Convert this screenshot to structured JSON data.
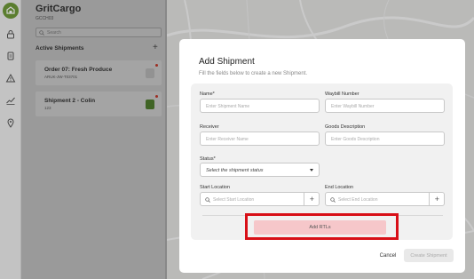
{
  "sidebar": {
    "brand": "GritCargo",
    "code": "GCCH03",
    "search_placeholder": "Search",
    "active_title": "Active Shipments",
    "shipments": [
      {
        "title": "Order 07: Fresh Produce",
        "subtitle": "ARUK-JW-T03701"
      },
      {
        "title": "Shipment 2 - Colin",
        "subtitle": "123"
      }
    ]
  },
  "colors": {
    "brand_green": "#6f9a3a",
    "highlight_red": "#d80f17",
    "rtl_button": "#f6c7ca"
  },
  "modal": {
    "title": "Add Shipment",
    "subtitle": "Fill the fields below to create a new Shipment.",
    "fields": {
      "name": {
        "label": "Name*",
        "placeholder": "Enter Shipment Name"
      },
      "waybill": {
        "label": "Waybill Number",
        "placeholder": "Enter Waybill Number"
      },
      "receiver": {
        "label": "Receiver",
        "placeholder": "Enter Receiver Name"
      },
      "goods": {
        "label": "Goods Description",
        "placeholder": "Enter Goods Description"
      },
      "status": {
        "label": "Status*",
        "value": "Select the shipment status"
      },
      "start": {
        "label": "Start Location",
        "placeholder": "Select Start Location"
      },
      "end": {
        "label": "End Location",
        "placeholder": "Select End Location"
      }
    },
    "add_rtls": "Add RTLs",
    "cancel": "Cancel",
    "create": "Create Shipment"
  }
}
